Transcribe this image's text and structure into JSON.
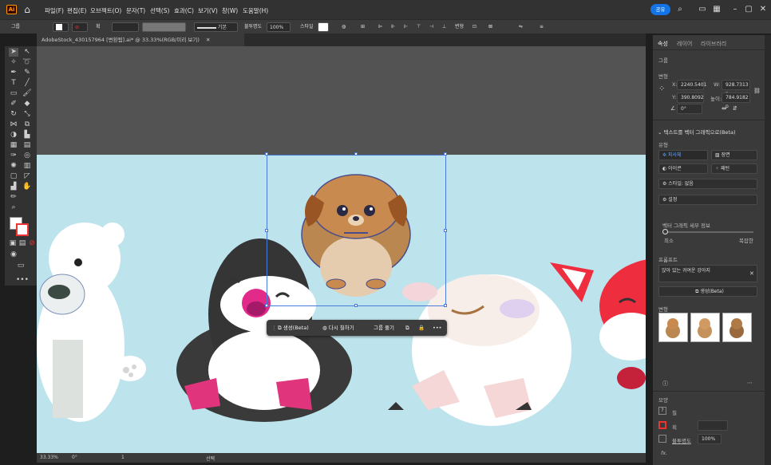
{
  "app": {
    "logo_text": "Ai"
  },
  "menu": [
    "파일(F)",
    "편집(E)",
    "오브젝트(O)",
    "문자(T)",
    "선택(S)",
    "효과(C)",
    "보기(V)",
    "창(W)",
    "도움말(H)"
  ],
  "share_label": "공유",
  "control_bar": {
    "selection_type": "그룹",
    "stroke_label": "획",
    "stroke_style": "기본",
    "opacity_label": "불투명도",
    "opacity_value": "100%",
    "style_label": "스타일",
    "transform_label": "변형"
  },
  "document_tab": {
    "title": "AdobeStock_430157964 [변환됨].ai* @ 33.33%(RGB/미리 보기)"
  },
  "status": {
    "zoom": "33.33%",
    "rotation": "0°",
    "artboard": "1",
    "mode": "선택"
  },
  "context_bar": {
    "generate": "생성(Beta)",
    "recolor": "다시 칠하기",
    "ungroup": "그룹 풀기"
  },
  "panel": {
    "tabs": [
      "속성",
      "레이어",
      "라이브러리"
    ],
    "section_group": "그룹",
    "section_transform": "변형",
    "x_label": "X:",
    "x_value": "2240.5401",
    "y_label": "Y:",
    "y_value": "390.8092 p",
    "w_label": "W:",
    "w_value": "928.7313 p",
    "h_label": "높이:",
    "h_value": "784.9182 p",
    "angle_value": "0°",
    "text_to_vector_title": "텍스트를 벡터 그래픽으로(Beta)",
    "type_label": "유형",
    "types": [
      "피사체",
      "장면",
      "아이콘",
      "패턴"
    ],
    "style_label": "스타일: 없음",
    "settings_label": "설정",
    "detail_label": "벡터 그래픽 세부 정보",
    "detail_min": "최소",
    "detail_max": "복잡한",
    "prompt_label": "프롬프트",
    "prompt_text": "앉아 있는 귀여운 강아지",
    "generate_button": "생성(Beta)",
    "variations_label": "변형",
    "appearance_label": "모양",
    "fill_label": "칠",
    "stroke_label": "획",
    "opacity_label": "불투명도",
    "opacity_value": "100%",
    "fx_label": "fx."
  },
  "colors": {
    "accent": "#1473e6",
    "artboard": "#bde3ec",
    "selection": "#4a7bd8"
  }
}
